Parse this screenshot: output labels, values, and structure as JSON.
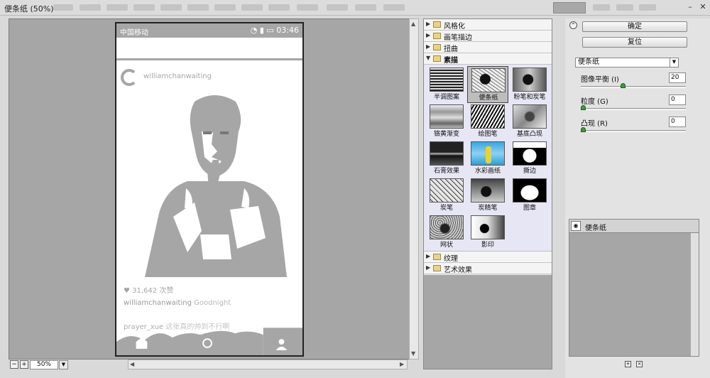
{
  "window": {
    "title": "便条纸 (50%)"
  },
  "phone": {
    "carrier": "中国移动",
    "time": "03:46",
    "username": "williamchanwaiting",
    "likes": "31,642 次赞",
    "caption_user": "williamchanwaiting",
    "caption_text": "Goodnight",
    "comment_user": "prayer_xue",
    "comment_text": "这张真的帅到不行啊"
  },
  "zoom": {
    "value": "50%",
    "minus": "−",
    "plus": "+"
  },
  "categories": {
    "stylize": "风格化",
    "brush": "画笔描边",
    "distort": "扭曲",
    "sketch": "素描",
    "texture": "纹理",
    "artistic": "艺术效果"
  },
  "sketch_filters": [
    "半调图案",
    "便条纸",
    "粉笔和炭笔",
    "铬黄渐变",
    "绘图笔",
    "基底凸现",
    "石膏效果",
    "水彩画纸",
    "撕边",
    "炭笔",
    "炭精笔",
    "图章",
    "网状",
    "影印"
  ],
  "selected_filter": "便条纸",
  "buttons": {
    "ok": "确定",
    "reset": "复位"
  },
  "settings": {
    "filter": "便条纸",
    "params": [
      {
        "label": "图像平衡 (I)",
        "value": "20",
        "fraction": 0.4
      },
      {
        "label": "粒度 (G)",
        "value": "0",
        "fraction": 0
      },
      {
        "label": "凸现 (R)",
        "value": "0",
        "fraction": 0
      }
    ]
  },
  "layers": {
    "effect": "便条纸"
  }
}
